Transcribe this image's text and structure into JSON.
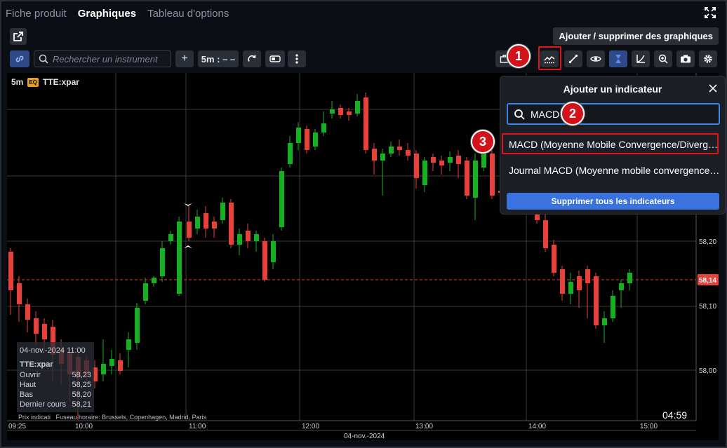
{
  "tabs": [
    "Fiche produit",
    "Graphiques",
    "Tableau d'options"
  ],
  "header": {
    "add_remove_charts": "Ajouter / supprimer des graphiques"
  },
  "toolbar": {
    "search_placeholder": "Rechercher un instrument",
    "plus": "+",
    "interval": "5m : – –"
  },
  "chart": {
    "interval": "5m",
    "badge": "EQ",
    "symbol": "TTE:xpar",
    "price_labels": [
      "58,20",
      "58,10",
      "58,00"
    ],
    "current_price": "58,14",
    "time_labels": [
      "09:25",
      "10:00",
      "11:00",
      "12:00",
      "13:00",
      "14:00",
      "15:00"
    ],
    "date_label": "04-nov.-2024",
    "countdown": "04:59",
    "footnote_left": "Prix indicati",
    "footnote_right": "Fuseau horaire: Brussels, Copenhagen, Madrid, Paris",
    "info": {
      "date": "04-nov.-2024 11:00",
      "symbol": "TTE:xpar",
      "rows": [
        {
          "label": "Ouvrir",
          "value": "58,23"
        },
        {
          "label": "Haut",
          "value": "58,25"
        },
        {
          "label": "Bas",
          "value": "58,20"
        },
        {
          "label": "Dernier cours",
          "value": "58,21"
        }
      ]
    },
    "colors": {
      "up": "#16b022",
      "down": "#e8403a",
      "accent": "#3a72e0",
      "highlight": "#e0161b"
    }
  },
  "panel": {
    "title": "Ajouter un indicateur",
    "search_value": "MACD",
    "items": [
      "MACD (Moyenne Mobile Convergence/Divergence)",
      "Journal MACD (Moyenne mobile convergence/divergence)"
    ],
    "remove_all": "Supprimer tous les indicateurs"
  },
  "annotations": [
    "1",
    "2",
    "3"
  ]
}
